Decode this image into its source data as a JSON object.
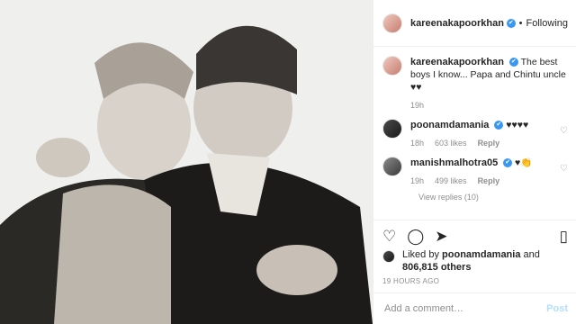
{
  "post": {
    "image_alt": "Black and white photo of two boys"
  },
  "header": {
    "username": "kareenakapoorkhan",
    "separator": "•",
    "follow_status": "Following"
  },
  "comments": [
    {
      "username": "kareenakapoorkhan",
      "text": "The best boys I know... Papa and Chintu uncle ♥♥",
      "time": "19h",
      "verified": true
    },
    {
      "username": "poonamdamania",
      "text": "♥♥♥♥",
      "time": "18h",
      "likes": "603 likes",
      "reply": "Reply",
      "verified": true
    },
    {
      "username": "manishmalhotra05",
      "text": "♥👏",
      "time": "19h",
      "likes": "499 likes",
      "reply": "Reply",
      "verified": true
    }
  ],
  "view_replies": "View replies (10)",
  "likes": {
    "prefix": "Liked by",
    "user": "poonamdamania",
    "and": "and",
    "count": "806,815 others"
  },
  "timestamp": "19 HOURS AGO",
  "add_comment": {
    "placeholder": "Add a comment…",
    "post_label": "Post"
  },
  "icons": {
    "verified": "✔",
    "heart": "♡",
    "comment": "◯",
    "share": "➤",
    "bookmark": "▯"
  }
}
